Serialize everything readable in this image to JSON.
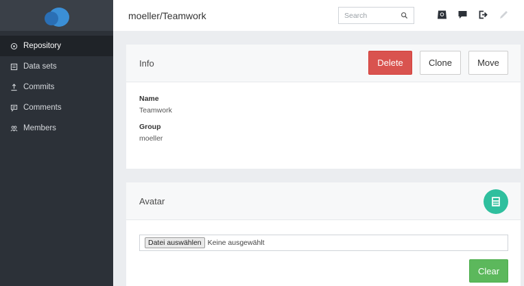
{
  "header": {
    "title": "moeller/Teamwork",
    "search_placeholder": "Search",
    "icons": [
      "inbox-icon",
      "chat-icon",
      "logout-icon",
      "edit-icon"
    ]
  },
  "sidebar": {
    "items": [
      {
        "label": "Repository",
        "icon": "repository-icon",
        "active": true
      },
      {
        "label": "Data sets",
        "icon": "dataset-icon",
        "active": false
      },
      {
        "label": "Commits",
        "icon": "commit-icon",
        "active": false
      },
      {
        "label": "Comments",
        "icon": "comment-icon",
        "active": false
      },
      {
        "label": "Members",
        "icon": "members-icon",
        "active": false
      }
    ]
  },
  "info": {
    "title": "Info",
    "delete_label": "Delete",
    "clone_label": "Clone",
    "move_label": "Move",
    "fields": [
      {
        "label": "Name",
        "value": "Teamwork"
      },
      {
        "label": "Group",
        "value": "moeller"
      }
    ]
  },
  "avatar": {
    "title": "Avatar",
    "file_button_label": "Datei auswählen",
    "file_status": "Keine ausgewählt",
    "clear_label": "Clear"
  },
  "colors": {
    "sidebar_bg": "#2c3138",
    "delete": "#d9534f",
    "clear": "#5cb85c",
    "avatar": "#2fbf9e",
    "logo": "#3b8fd6"
  }
}
